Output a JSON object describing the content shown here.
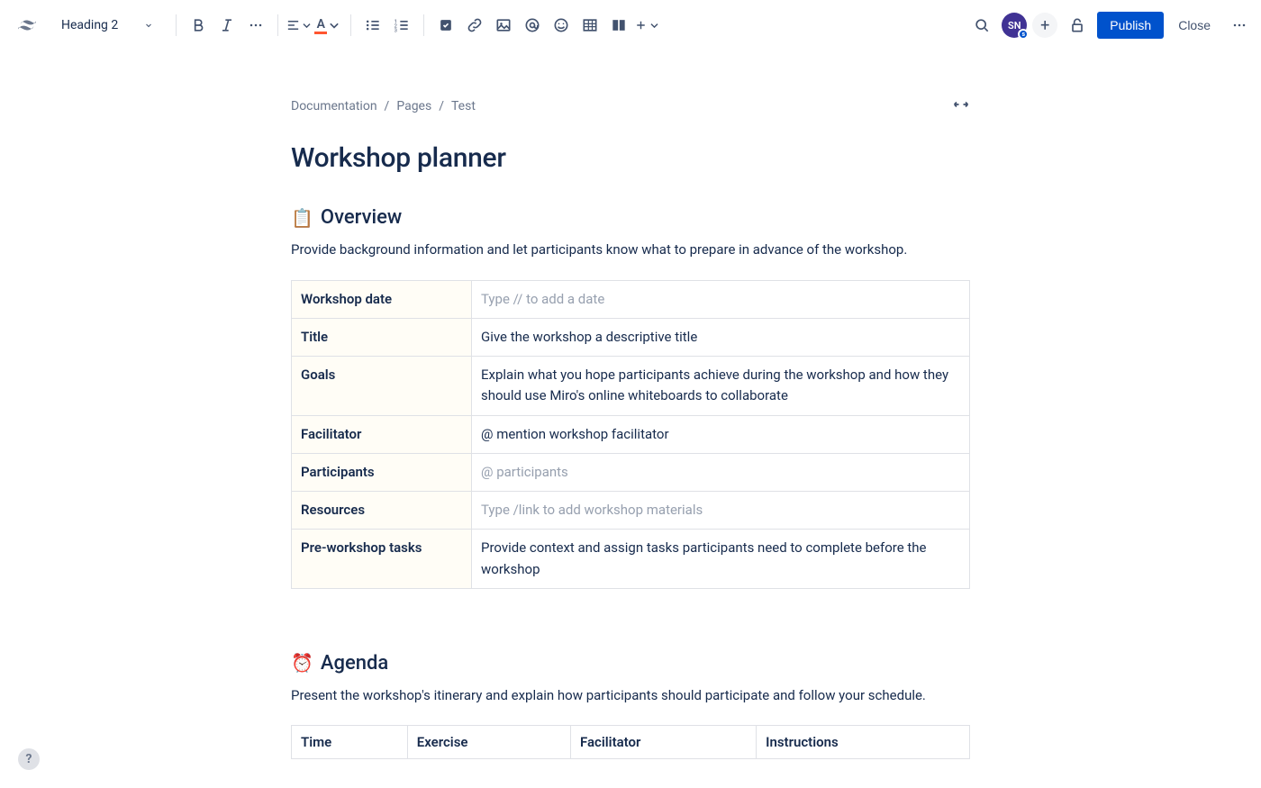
{
  "toolbar": {
    "heading_label": "Heading 2",
    "publish": "Publish",
    "close": "Close",
    "avatar_initials": "SN",
    "avatar_badge": "s"
  },
  "breadcrumb": {
    "items": [
      "Documentation",
      "Pages",
      "Test"
    ]
  },
  "page": {
    "title": "Workshop planner"
  },
  "overview": {
    "emoji": "📋",
    "heading": "Overview",
    "desc": "Provide background information and let participants know what to prepare in advance of the workshop.",
    "rows": [
      {
        "label": "Workshop date",
        "value": "Type // to add a date",
        "placeholder": true
      },
      {
        "label": "Title",
        "value": "Give the workshop a descriptive title",
        "placeholder": false
      },
      {
        "label": "Goals",
        "value": "Explain what you hope participants achieve during the workshop and how they should use Miro's online whiteboards to collaborate",
        "placeholder": false
      },
      {
        "label": "Facilitator",
        "value": "@ mention workshop facilitator",
        "placeholder": false
      },
      {
        "label": "Participants",
        "value": "@ participants",
        "placeholder": true
      },
      {
        "label": "Resources",
        "value": "Type /link to add workshop materials",
        "placeholder": true
      },
      {
        "label": "Pre-workshop tasks",
        "value": "Provide context and assign tasks participants need to complete before the workshop",
        "placeholder": false
      }
    ]
  },
  "agenda": {
    "emoji": "⏰",
    "heading": "Agenda",
    "desc": "Present the workshop's itinerary and explain how participants should participate and follow your schedule.",
    "columns": [
      "Time",
      "Exercise",
      "Facilitator",
      "Instructions"
    ]
  }
}
